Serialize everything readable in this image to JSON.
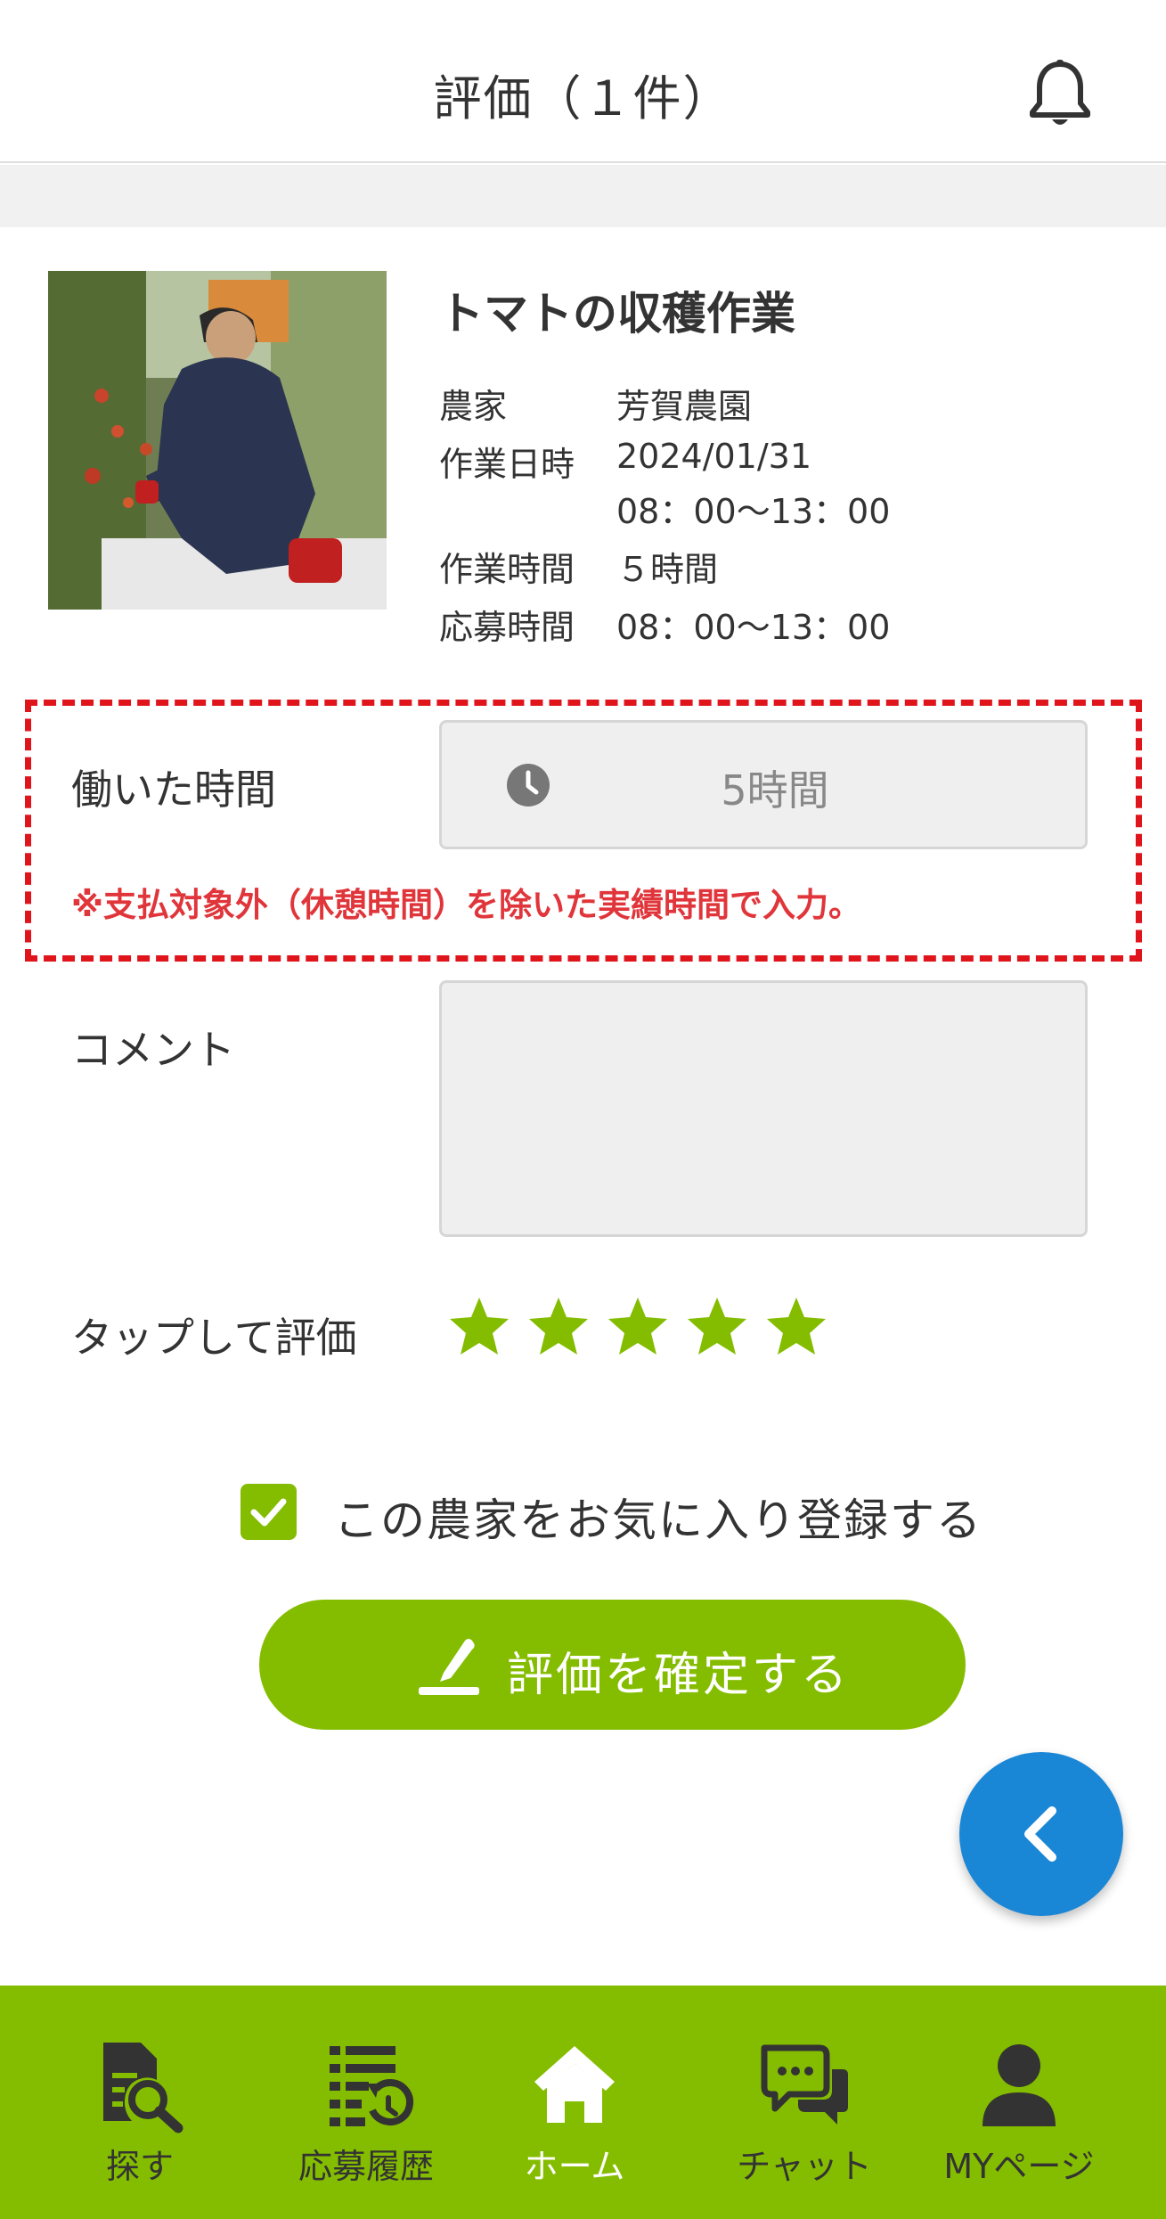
{
  "header": {
    "title": "評価（１件）",
    "bell_icon": "bell-icon"
  },
  "job": {
    "title": "トマトの収穫作業",
    "photo_alt": "トマトの収穫作業",
    "fields": [
      {
        "label": "農家",
        "value": "芳賀農園"
      },
      {
        "label": "作業日時",
        "value": "2024/01/31",
        "value2": "08：00〜13：00"
      },
      {
        "label": "作業時間",
        "value": "５時間"
      },
      {
        "label": "応募時間",
        "value": "08：00〜13：00"
      }
    ]
  },
  "form": {
    "worked_hours_label": "働いた時間",
    "worked_hours_value": "5時間",
    "worked_hours_note": "※支払対象外（休憩時間）を除いた実績時間で入力。",
    "comment_label": "コメント",
    "comment_value": "",
    "rating_label": "タップして評価",
    "rating": 5,
    "rating_max": 5,
    "favorite_label": "この農家をお気に入り登録する",
    "favorite_checked": true,
    "confirm_label": "評価を確定する"
  },
  "colors": {
    "brand_green": "#84bd00",
    "accent_blue": "#1a86d6",
    "alert_red": "#e0151c"
  },
  "nav": {
    "items": [
      {
        "label": "探す",
        "icon": "search-document-icon"
      },
      {
        "label": "応募履歴",
        "icon": "history-list-icon"
      },
      {
        "label": "ホーム",
        "icon": "home-icon",
        "active": true
      },
      {
        "label": "チャット",
        "icon": "chat-icon"
      },
      {
        "label": "MYページ",
        "icon": "user-icon"
      }
    ]
  }
}
